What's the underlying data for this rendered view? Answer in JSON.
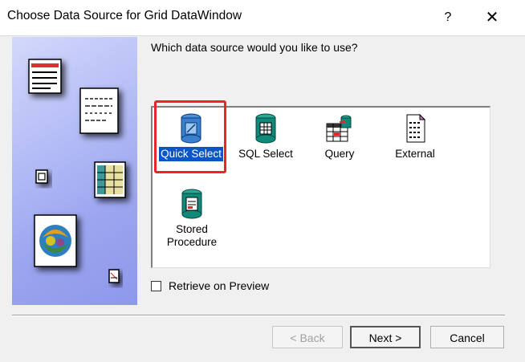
{
  "window": {
    "title": "Choose Data Source for Grid DataWindow",
    "help_glyph": "?",
    "close_glyph": "✕"
  },
  "question": "Which data source would you like to use?",
  "data_sources": [
    {
      "line1": "Quick Select",
      "line2": "",
      "icon": "quick-select-database-icon",
      "selected": true
    },
    {
      "line1": "SQL Select",
      "line2": "",
      "icon": "sql-select-database-icon",
      "selected": false
    },
    {
      "line1": "Query",
      "line2": "",
      "icon": "query-grid-icon",
      "selected": false
    },
    {
      "line1": "External",
      "line2": "",
      "icon": "external-document-icon",
      "selected": false
    },
    {
      "line1": "Stored",
      "line2": "Procedure",
      "icon": "stored-procedure-database-icon",
      "selected": false
    }
  ],
  "retrieve_on_preview": {
    "label": "Retrieve on Preview",
    "checked": false
  },
  "buttons": {
    "back": "< Back",
    "next": "Next >",
    "cancel": "Cancel"
  },
  "colors": {
    "selection": "#0a56c7",
    "db_teal": "#0f8a7a",
    "annotation_red": "#e8262a",
    "side_panel": "#a4adf2"
  }
}
